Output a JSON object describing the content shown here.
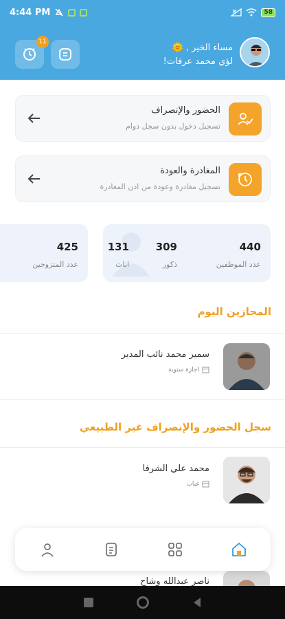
{
  "status_bar": {
    "time": "4:44 PM",
    "battery": "58"
  },
  "header": {
    "greeting": "مساء الخير ,",
    "greeting_emoji": "🌞",
    "user_name": "لؤي محمد عرفات!",
    "notification_count": "11"
  },
  "actions": [
    {
      "title": "الحضور والإنصراف",
      "subtitle": "تسجيل دخول بدون سجل دوام"
    },
    {
      "title": "المغادرة والعودة",
      "subtitle": "تسجيل مغادرة وعودة من اذن المغادرة"
    }
  ],
  "stats": {
    "employees": {
      "value": "440",
      "label": "عدد الموظفين"
    },
    "males": {
      "value": "309",
      "label": "ذكور"
    },
    "females": {
      "value": "131",
      "label": "اناث"
    },
    "married": {
      "value": "425",
      "label": "عدد المتزوجين"
    }
  },
  "sections": {
    "leaves_today": "المجازين اليوم",
    "abnormal_attendance": "سجل الحضور والإنصراف غير الطبيعي"
  },
  "leaves": [
    {
      "name": "سمير محمد نائب المدير",
      "type": "اجازة سنوية"
    }
  ],
  "abnormal": [
    {
      "name": "محمد علي الشرفا",
      "type": "غياب"
    },
    {
      "name": "ناصر عبدالله وشاح"
    }
  ],
  "icons": {
    "notifications": "calendar-clock-icon",
    "documents": "document-icon",
    "attendance": "user-check-icon",
    "departure": "clock-history-icon",
    "back": "arrow-left-icon",
    "nav_profile": "person-icon",
    "nav_documents": "file-text-icon",
    "nav_apps": "grid-icon",
    "nav_home": "home-icon"
  },
  "colors": {
    "primary": "#4aa8e0",
    "accent": "#f4a42a",
    "section_title": "#f0a020"
  }
}
